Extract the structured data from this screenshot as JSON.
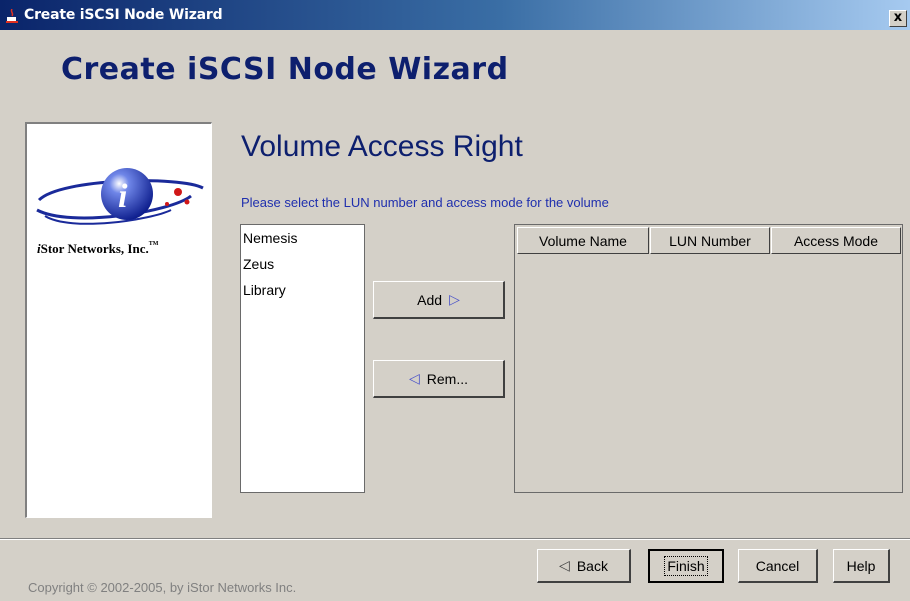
{
  "window": {
    "title": "Create iSCSI Node Wizard",
    "close_glyph": "x",
    "title_icon": "java-cup-icon"
  },
  "wizard": {
    "heading": "Create iSCSI Node Wizard"
  },
  "logo": {
    "company_i": "i",
    "company_rest": "Stor Networks, Inc.",
    "trademark": "TM",
    "emblem_letter": "i"
  },
  "page": {
    "title": "Volume Access Right",
    "instruction": "Please select the LUN number and access mode for the volume"
  },
  "volume_list": [
    "Nemesis",
    "Zeus",
    "Library"
  ],
  "buttons": {
    "add_label": "Add",
    "add_icon": "▷",
    "remove_label": "Rem...",
    "remove_icon": "◁"
  },
  "table": {
    "columns": [
      "Volume Name",
      "LUN Number",
      "Access Mode"
    ],
    "rows": []
  },
  "footer": {
    "back_label": "Back",
    "back_icon": "◁",
    "finish_label": "Finish",
    "cancel_label": "Cancel",
    "help_label": "Help",
    "copyright": "Copyright © 2002-2005, by iStor Networks Inc."
  },
  "colors": {
    "title_gradient_start": "#0a246a",
    "heading": "#0d1f6e",
    "instruction": "#1f2fae",
    "panel_bg": "#d4d0c8"
  }
}
